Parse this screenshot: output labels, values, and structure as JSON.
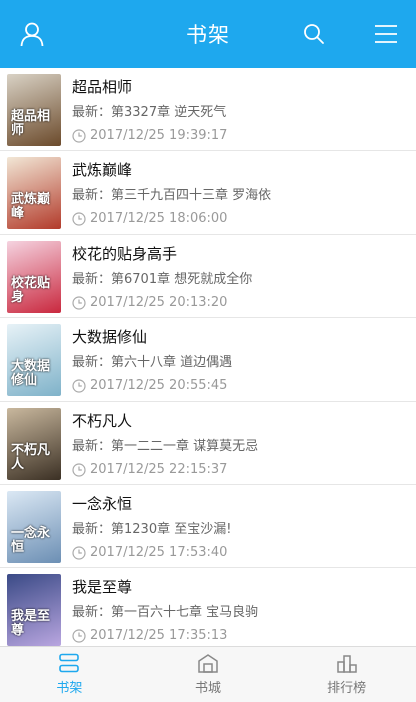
{
  "header": {
    "title": "书架",
    "left_icon": "user-icon",
    "right_icons": [
      "search-icon",
      "menu-icon"
    ],
    "color": "#1ea8ee"
  },
  "books": [
    {
      "title": "超品相师",
      "latest": "最新：第3327章 逆天死气",
      "time": "2017/12/25 19:39:17",
      "cover_text": "超品相师",
      "cover_colors": [
        "#d9d2c5",
        "#6b4a2b"
      ]
    },
    {
      "title": "武炼巅峰",
      "latest": "最新：第三千九百四十三章 罗海依",
      "time": "2017/12/25 18:06:00",
      "cover_text": "武炼巅峰",
      "cover_colors": [
        "#f2e7d6",
        "#b23a2a"
      ]
    },
    {
      "title": "校花的贴身高手",
      "latest": "最新：第6701章 想死就成全你",
      "time": "2017/12/25 20:13:20",
      "cover_text": "校花贴身",
      "cover_colors": [
        "#f5d3e0",
        "#c9283e"
      ]
    },
    {
      "title": "大数据修仙",
      "latest": "最新：第六十八章 道边偶遇",
      "time": "2017/12/25 20:55:45",
      "cover_text": "大数据修仙",
      "cover_colors": [
        "#e7f2f7",
        "#7fb2c9"
      ]
    },
    {
      "title": "不朽凡人",
      "latest": "最新：第一二二一章 谋算莫无忌",
      "time": "2017/12/25 22:15:37",
      "cover_text": "不朽凡人",
      "cover_colors": [
        "#c9b89e",
        "#3b3024"
      ]
    },
    {
      "title": "一念永恒",
      "latest": "最新：第1230章 至宝沙漏!",
      "time": "2017/12/25 17:53:40",
      "cover_text": "一念永恒",
      "cover_colors": [
        "#dbe8f4",
        "#6c8fb4"
      ]
    },
    {
      "title": "我是至尊",
      "latest": "最新：第一百六十七章 宝马良驹",
      "time": "2017/12/25 17:35:13",
      "cover_text": "我是至尊",
      "cover_colors": [
        "#3a4a86",
        "#b9a6e0"
      ]
    }
  ],
  "tabs": [
    {
      "label": "书架",
      "icon": "bookshelf-icon",
      "active": true
    },
    {
      "label": "书城",
      "icon": "store-icon",
      "active": false
    },
    {
      "label": "排行榜",
      "icon": "ranking-icon",
      "active": false
    }
  ]
}
